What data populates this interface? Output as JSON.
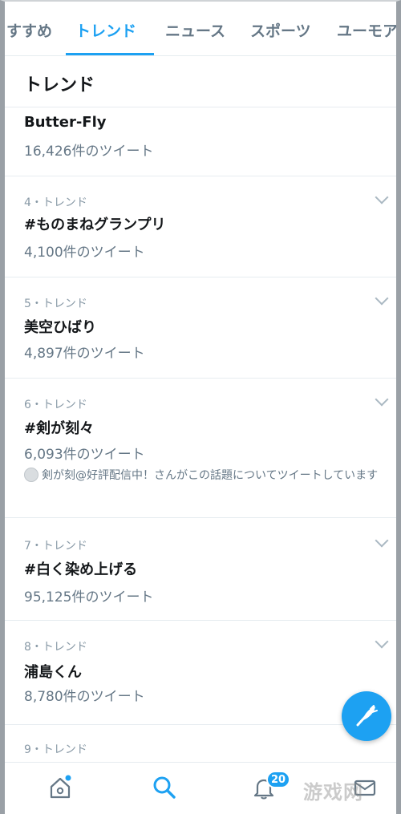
{
  "tabs": [
    {
      "label": "すすめ",
      "active": false
    },
    {
      "label": "トレンド",
      "active": true
    },
    {
      "label": "ニュース",
      "active": false
    },
    {
      "label": "スポーツ",
      "active": false
    },
    {
      "label": "ユーモア",
      "active": false
    }
  ],
  "section_title": "トレンド",
  "trends": [
    {
      "rank": "",
      "name": "Butter-Fly",
      "count": "16,426件のツイート",
      "context": ""
    },
    {
      "rank": "4・トレンド",
      "name": "#ものまねグランプリ",
      "count": "4,100件のツイート",
      "context": ""
    },
    {
      "rank": "5・トレンド",
      "name": "美空ひばり",
      "count": "4,897件のツイート",
      "context": ""
    },
    {
      "rank": "6・トレンド",
      "name": "#剣が刻々",
      "count": "6,093件のツイート",
      "context": "剣が刻@好評配信中！さんがこの話題についてツイートしています"
    },
    {
      "rank": "7・トレンド",
      "name": "#白く染め上げる",
      "count": "95,125件のツイート",
      "context": ""
    },
    {
      "rank": "8・トレンド",
      "name": "浦島くん",
      "count": "8,780件のツイート",
      "context": ""
    },
    {
      "rank": "9・トレンド",
      "name": "",
      "count": "",
      "context": ""
    }
  ],
  "bottom_nav": {
    "items": [
      {
        "icon": "home-icon",
        "active": false,
        "dot": true
      },
      {
        "icon": "search-icon",
        "active": true
      },
      {
        "icon": "bell-icon",
        "active": false
      },
      {
        "icon": "mail-icon",
        "active": false
      }
    ],
    "notification_badge": "20"
  },
  "fab_icon": "compose-feather-icon",
  "watermark": "游戏网",
  "colors": {
    "accent": "#1da1f2",
    "text": "#14171a",
    "muted": "#657786",
    "divider": "#e6ecf0"
  }
}
